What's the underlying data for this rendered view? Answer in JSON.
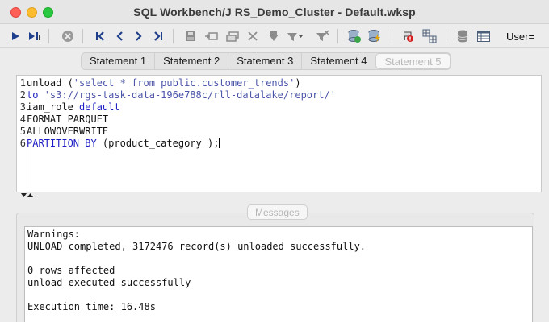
{
  "window": {
    "title": "SQL Workbench/J RS_Demo_Cluster - Default.wksp"
  },
  "toolbar": {
    "user_label": "User=",
    "buttons": [
      "execute-icon",
      "execute-current-icon",
      "stop-icon",
      "first-icon",
      "previous-icon",
      "next-icon",
      "last-icon",
      "save-icon",
      "insert-row-icon",
      "copy-row-icon",
      "delete-row-icon",
      "filter-icon",
      "filter-dropdown-icon",
      "clear-filter-icon",
      "database-icon",
      "commit-icon",
      "error-icon",
      "table-grid-icon",
      "db-explorer-icon",
      "result-grid-icon"
    ]
  },
  "tabs": [
    {
      "label": "Statement 1",
      "active": false
    },
    {
      "label": "Statement 2",
      "active": false
    },
    {
      "label": "Statement 3",
      "active": false
    },
    {
      "label": "Statement 4",
      "active": false
    },
    {
      "label": "Statement 5",
      "active": true
    }
  ],
  "editor": {
    "line_numbers": [
      "1",
      "2",
      "3",
      "4",
      "5",
      "6"
    ],
    "lines": [
      {
        "parts": [
          {
            "t": "unload (",
            "c": "plain"
          },
          {
            "t": "'select * from public.customer_trends'",
            "c": "str"
          },
          {
            "t": ")",
            "c": "plain"
          }
        ]
      },
      {
        "parts": [
          {
            "t": "to ",
            "c": "kw"
          },
          {
            "t": "'s3://rgs-task-data-196e788c/rll-datalake/report/'",
            "c": "str"
          }
        ]
      },
      {
        "parts": [
          {
            "t": "iam_role ",
            "c": "plain"
          },
          {
            "t": "default",
            "c": "kw"
          }
        ]
      },
      {
        "parts": [
          {
            "t": "FORMAT PARQUET",
            "c": "plain"
          }
        ]
      },
      {
        "parts": [
          {
            "t": "ALLOWOVERWRITE",
            "c": "plain"
          }
        ]
      },
      {
        "parts": [
          {
            "t": "PARTITION BY",
            "c": "kw"
          },
          {
            "t": " (product_category );",
            "c": "plain"
          }
        ]
      }
    ]
  },
  "messages": {
    "tab_label": "Messages",
    "lines": [
      "Warnings:",
      "UNLOAD completed, 3172476 record(s) unloaded successfully.",
      "",
      "0 rows affected",
      "unload executed successfully",
      "",
      "Execution time: 16.48s"
    ]
  },
  "colors": {
    "keyword": "#1c1cc4",
    "string": "#4a54a8",
    "close": "#fe5f57",
    "minimize": "#febc2e",
    "maximize": "#28c840"
  }
}
